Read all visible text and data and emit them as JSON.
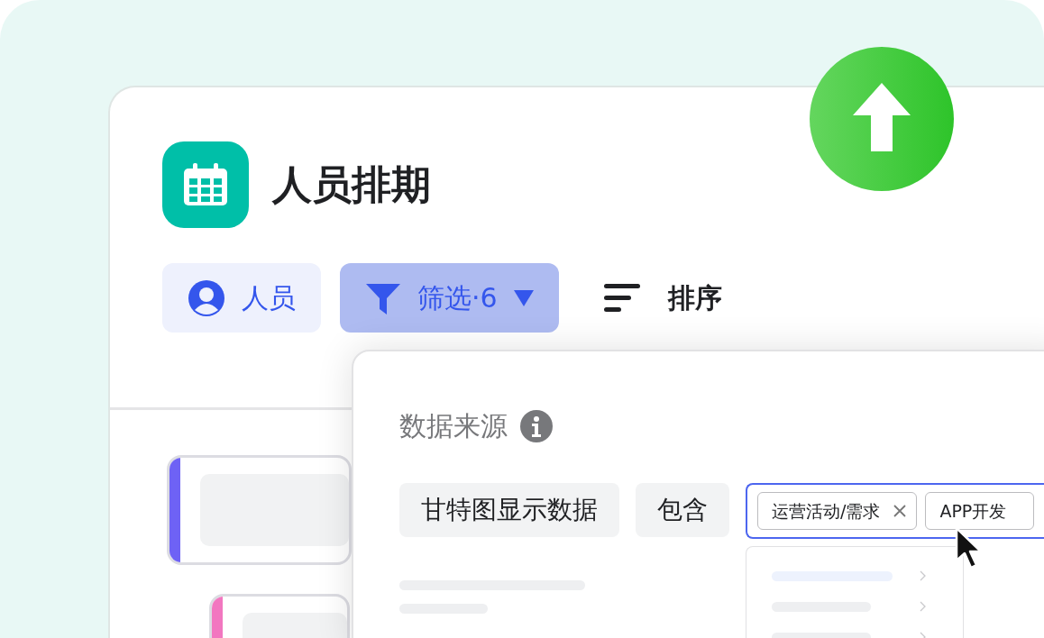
{
  "app": {
    "title": "人员排期"
  },
  "toolbar": [
    {
      "kind": "people",
      "label": "人员",
      "selected": false
    },
    {
      "kind": "filter",
      "label": "筛选·6",
      "selected": true
    },
    {
      "kind": "sort",
      "label": "排序",
      "selected": false
    }
  ],
  "filter_panel": {
    "heading": "数据来源",
    "field": "甘特图显示数据",
    "operator": "包含",
    "tags": [
      {
        "label": "运营活动/需求"
      },
      {
        "label": "APP开发"
      }
    ]
  },
  "gantt_bars": [
    {
      "color": "#6e62f5"
    },
    {
      "color": "#f277c0"
    }
  ]
}
